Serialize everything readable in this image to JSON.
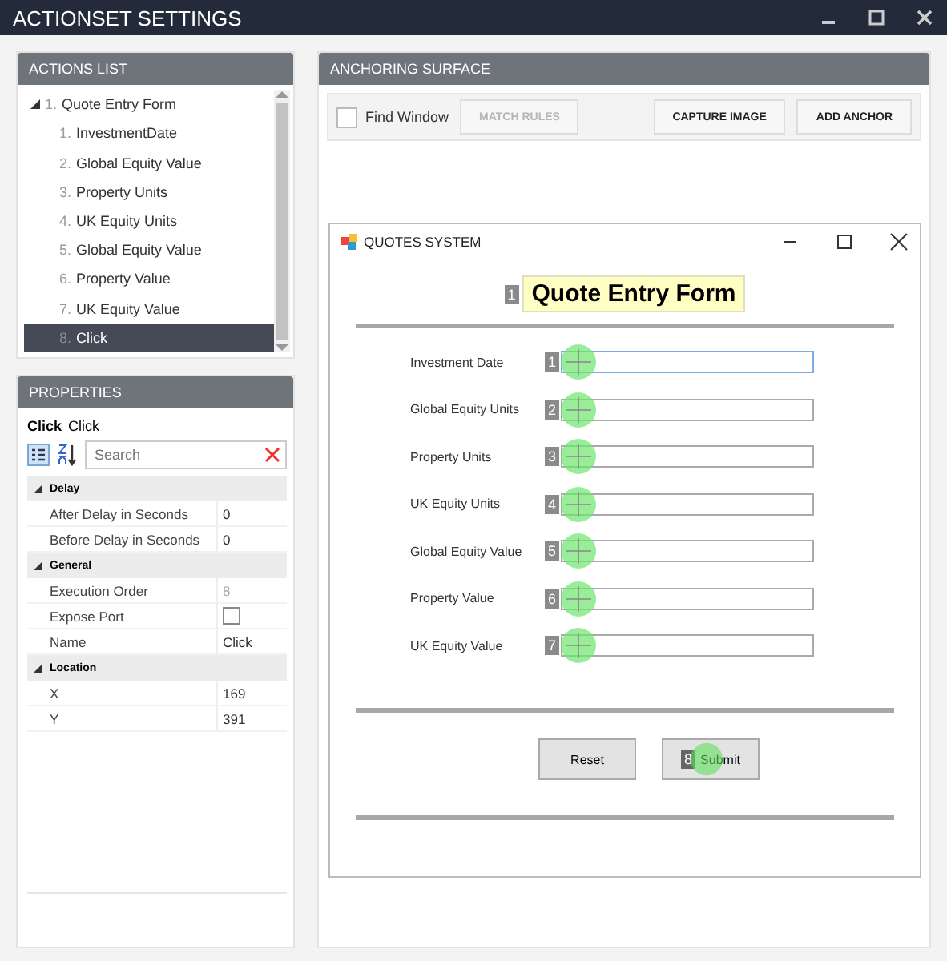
{
  "window": {
    "title": "ACTIONSET SETTINGS"
  },
  "actions_list": {
    "title": "ACTIONS LIST",
    "root": {
      "number": "1.",
      "label": "Quote Entry Form",
      "expanded": true,
      "children": [
        {
          "number": "1.",
          "label": "InvestmentDate",
          "selected": false
        },
        {
          "number": "2.",
          "label": "Global Equity Value",
          "selected": false
        },
        {
          "number": "3.",
          "label": "Property Units",
          "selected": false
        },
        {
          "number": "4.",
          "label": "UK Equity Units",
          "selected": false
        },
        {
          "number": "5.",
          "label": "Global Equity Value",
          "selected": false
        },
        {
          "number": "6.",
          "label": "Property Value",
          "selected": false
        },
        {
          "number": "7.",
          "label": "UK Equity Value",
          "selected": false
        },
        {
          "number": "8.",
          "label": "Click",
          "selected": true
        }
      ]
    }
  },
  "properties": {
    "title": "PROPERTIES",
    "object_name": "Click",
    "object_type": "Click",
    "search_placeholder": "Search",
    "categories": [
      {
        "name": "Delay",
        "expanded": true,
        "rows": [
          {
            "name": "After Delay in Seconds",
            "value": "0",
            "kind": "text"
          },
          {
            "name": "Before Delay in Seconds",
            "value": "0",
            "kind": "text"
          }
        ]
      },
      {
        "name": "General",
        "expanded": true,
        "rows": [
          {
            "name": "Execution Order",
            "value": "8",
            "kind": "readonly"
          },
          {
            "name": "Expose Port",
            "kind": "checkbox",
            "checked": false
          },
          {
            "name": "Name",
            "value": "Click",
            "kind": "text"
          }
        ]
      },
      {
        "name": "Location",
        "expanded": true,
        "rows": [
          {
            "name": "X",
            "value": "169",
            "kind": "text"
          },
          {
            "name": "Y",
            "value": "391",
            "kind": "text"
          }
        ]
      }
    ]
  },
  "anchoring": {
    "title": "ANCHORING SURFACE",
    "find_window": {
      "label": "Find Window",
      "checked": false
    },
    "buttons": [
      {
        "label": "MATCH RULES",
        "disabled": true
      },
      {
        "label": "CAPTURE IMAGE",
        "disabled": false
      },
      {
        "label": "ADD ANCHOR",
        "disabled": false
      }
    ],
    "app_window": {
      "title": "QUOTES SYSTEM",
      "form_title": "Quote Entry Form",
      "title_badge": "1",
      "fields": [
        {
          "label": "Investment Date",
          "badge": "1",
          "focused": true
        },
        {
          "label": "Global Equity Units",
          "badge": "2",
          "focused": false
        },
        {
          "label": "Property Units",
          "badge": "3",
          "focused": false
        },
        {
          "label": "UK Equity Units",
          "badge": "4",
          "focused": false
        },
        {
          "label": "Global Equity Value",
          "badge": "5",
          "focused": false
        },
        {
          "label": "Property Value",
          "badge": "6",
          "focused": false
        },
        {
          "label": "UK Equity Value",
          "badge": "7",
          "focused": false
        }
      ],
      "buttons": [
        {
          "label": "Reset"
        },
        {
          "label": "Submit",
          "badge": "8"
        }
      ]
    }
  }
}
